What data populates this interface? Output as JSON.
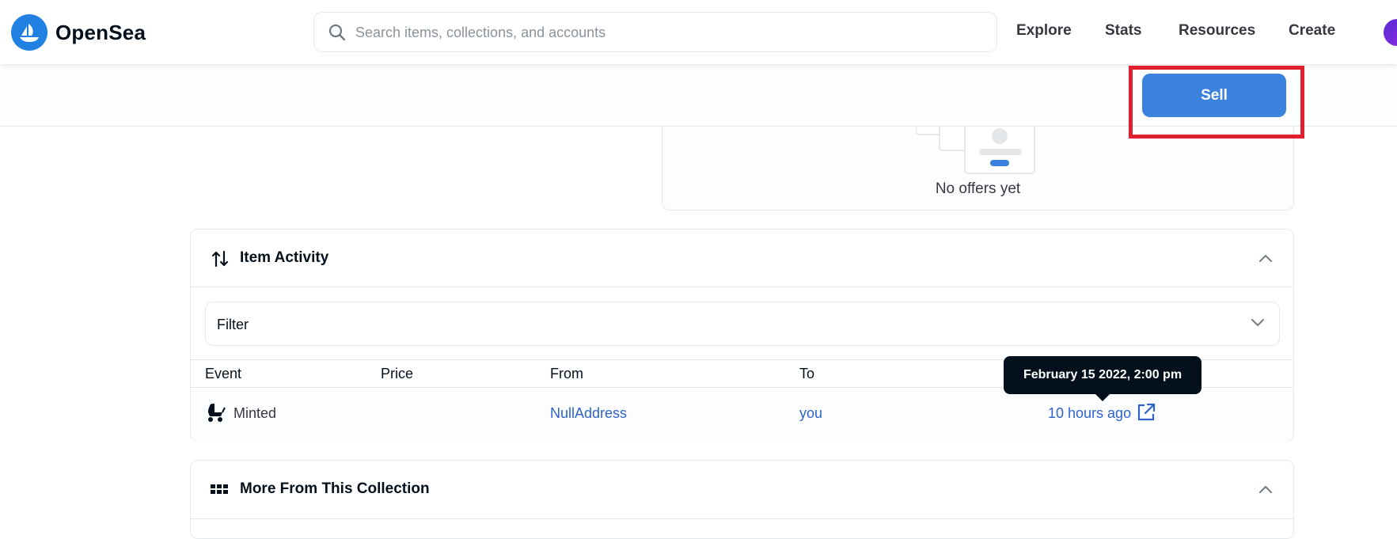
{
  "header": {
    "brand": "OpenSea",
    "search_placeholder": "Search items, collections, and accounts",
    "nav": [
      "Explore",
      "Stats",
      "Resources",
      "Create"
    ]
  },
  "actionbar": {
    "sell_label": "Sell"
  },
  "offers": {
    "empty_text": "No offers yet"
  },
  "activity": {
    "title": "Item Activity",
    "filter_label": "Filter",
    "columns": [
      "Event",
      "Price",
      "From",
      "To"
    ],
    "rows": [
      {
        "event": "Minted",
        "price": "",
        "from": "NullAddress",
        "to": "you",
        "date": "10 hours ago"
      }
    ],
    "tooltip": "February 15 2022, 2:00 pm"
  },
  "more": {
    "title": "More From This Collection"
  },
  "colors": {
    "accent": "#2081e2",
    "button": "#3b82de",
    "highlight": "#e0202c",
    "link": "#2f63c9"
  }
}
